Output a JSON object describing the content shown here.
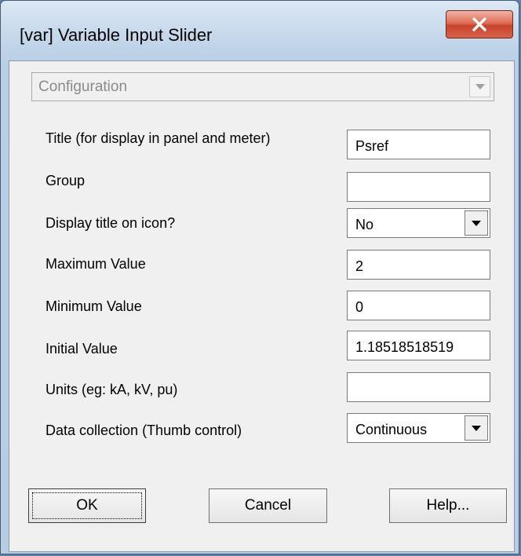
{
  "window": {
    "title": "[var] Variable Input Slider"
  },
  "config_dropdown": {
    "value": "Configuration"
  },
  "fields": {
    "title": {
      "label": "Title (for display in panel and meter)",
      "value": "Psref"
    },
    "group": {
      "label": "Group",
      "value": ""
    },
    "display_title": {
      "label": "Display title on icon?",
      "value": "No"
    },
    "max": {
      "label": "Maximum Value",
      "value": "2"
    },
    "min": {
      "label": "Minimum Value",
      "value": "0"
    },
    "initial": {
      "label": "Initial Value",
      "value": "1.18518518519"
    },
    "units": {
      "label": "Units (eg: kA, kV, pu)",
      "value": ""
    },
    "data_collection": {
      "label": "Data collection (Thumb control)",
      "value": "Continuous"
    }
  },
  "buttons": {
    "ok": "OK",
    "cancel": "Cancel",
    "help": "Help..."
  },
  "icons": {
    "close": "close-icon",
    "dropdown": "chevron-down-icon"
  },
  "colors": {
    "close_button": "#c7432d",
    "client_bg": "#f0f0f0",
    "frame": "#b9cfe6"
  }
}
